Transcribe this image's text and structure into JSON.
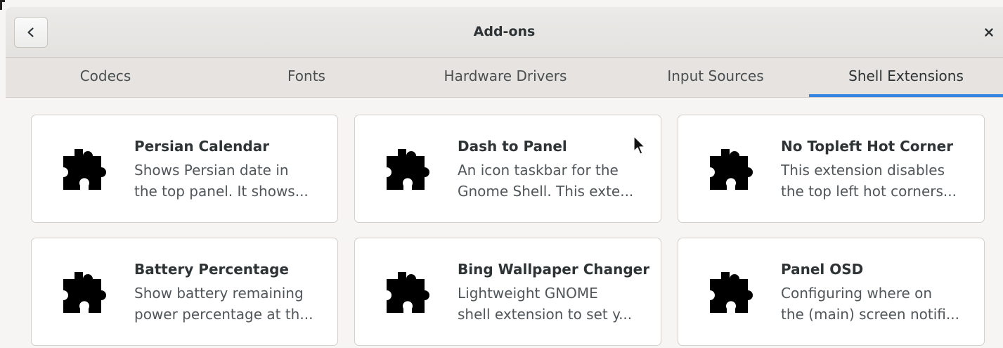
{
  "window": {
    "title": "Add-ons",
    "back_icon": "chevron-left-icon",
    "close_icon": "close-icon"
  },
  "tabs": [
    {
      "label": "Codecs"
    },
    {
      "label": "Fonts"
    },
    {
      "label": "Hardware Drivers"
    },
    {
      "label": "Input Sources"
    },
    {
      "label": "Shell Extensions",
      "active": true
    }
  ],
  "colors": {
    "accent": "#3584e4",
    "card_background": "#ffffff",
    "window_background": "#f6f5f4"
  },
  "extensions": [
    {
      "name": "Persian Calendar",
      "desc_line1": "Shows Persian date in",
      "desc_line2": "the top panel.  It shows...",
      "icon": "puzzle-piece-icon"
    },
    {
      "name": "Dash to Panel",
      "desc_line1": "An icon taskbar for the",
      "desc_line2": "Gnome Shell. This exte...",
      "icon": "puzzle-piece-icon"
    },
    {
      "name": "No Topleft Hot Corner",
      "desc_line1": "This extension disables",
      "desc_line2": "the top left hot corners...",
      "icon": "puzzle-piece-icon"
    },
    {
      "name": "Battery Percentage",
      "desc_line1": "Show battery remaining",
      "desc_line2": "power percentage at th...",
      "icon": "puzzle-piece-icon"
    },
    {
      "name": "Bing Wallpaper Changer",
      "desc_line1": "Lightweight GNOME",
      "desc_line2": "shell extension to set y...",
      "icon": "puzzle-piece-icon"
    },
    {
      "name": "Panel OSD",
      "desc_line1": "Configuring where on",
      "desc_line2": "the (main) screen notifi...",
      "icon": "puzzle-piece-icon"
    }
  ]
}
